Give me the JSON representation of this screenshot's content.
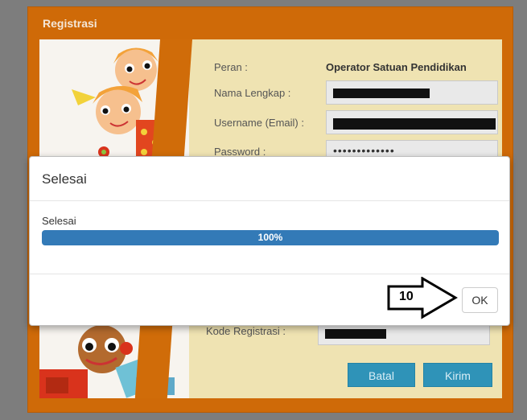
{
  "registration": {
    "title": "Registrasi",
    "labels": {
      "peran": "Peran :",
      "nama_lengkap": "Nama Lengkap :",
      "username": "Username (Email) :",
      "password": "Password :",
      "kode_registrasi": "Kode Registrasi :"
    },
    "peran_value": "Operator Satuan Pendidikan",
    "password_value": "•••••••••••••",
    "buttons": {
      "batal": "Batal",
      "kirim": "Kirim"
    }
  },
  "modal": {
    "title": "Selesai",
    "body_text": "Selesai",
    "progress": {
      "value": 1.0,
      "label": "100%"
    },
    "ok_label": "OK"
  },
  "annotation": {
    "step_label": "10"
  },
  "colors": {
    "frame_orange": "#cf6a08",
    "form_bg": "#efe3b2",
    "progress_blue": "#337ab7",
    "button_blue": "#2f93b8"
  }
}
